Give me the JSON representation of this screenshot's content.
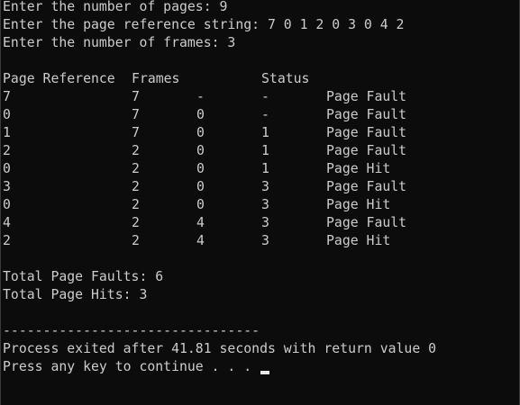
{
  "terminal": {
    "prompts": [
      "Enter the number of pages: 9",
      "Enter the page reference string: 7 0 1 2 0 3 0 4 2",
      "Enter the number of frames: 3"
    ],
    "table": {
      "headers": [
        "Page Reference",
        "Frames",
        "Status"
      ],
      "rows": [
        {
          "page": "7",
          "f1": "7",
          "f2": "-",
          "f3": "-",
          "status": "Page Fault"
        },
        {
          "page": "0",
          "f1": "7",
          "f2": "0",
          "f3": "-",
          "status": "Page Fault"
        },
        {
          "page": "1",
          "f1": "7",
          "f2": "0",
          "f3": "1",
          "status": "Page Fault"
        },
        {
          "page": "2",
          "f1": "2",
          "f2": "0",
          "f3": "1",
          "status": "Page Fault"
        },
        {
          "page": "0",
          "f1": "2",
          "f2": "0",
          "f3": "1",
          "status": "Page Hit"
        },
        {
          "page": "3",
          "f1": "2",
          "f2": "0",
          "f3": "3",
          "status": "Page Fault"
        },
        {
          "page": "0",
          "f1": "2",
          "f2": "0",
          "f3": "3",
          "status": "Page Hit"
        },
        {
          "page": "4",
          "f1": "2",
          "f2": "4",
          "f3": "3",
          "status": "Page Fault"
        },
        {
          "page": "2",
          "f1": "2",
          "f2": "4",
          "f3": "3",
          "status": "Page Hit"
        }
      ]
    },
    "totals": {
      "faults": "Total Page Faults: 6",
      "hits": "Total Page Hits: 3"
    },
    "separator": "--------------------------------",
    "exit_message": "Process exited after 41.81 seconds with return value 0",
    "continue_prompt": "Press any key to continue . . . "
  },
  "colors": {
    "background": "#0c0c0c",
    "text": "#cccccc",
    "cursor": "#e8e8e8"
  }
}
